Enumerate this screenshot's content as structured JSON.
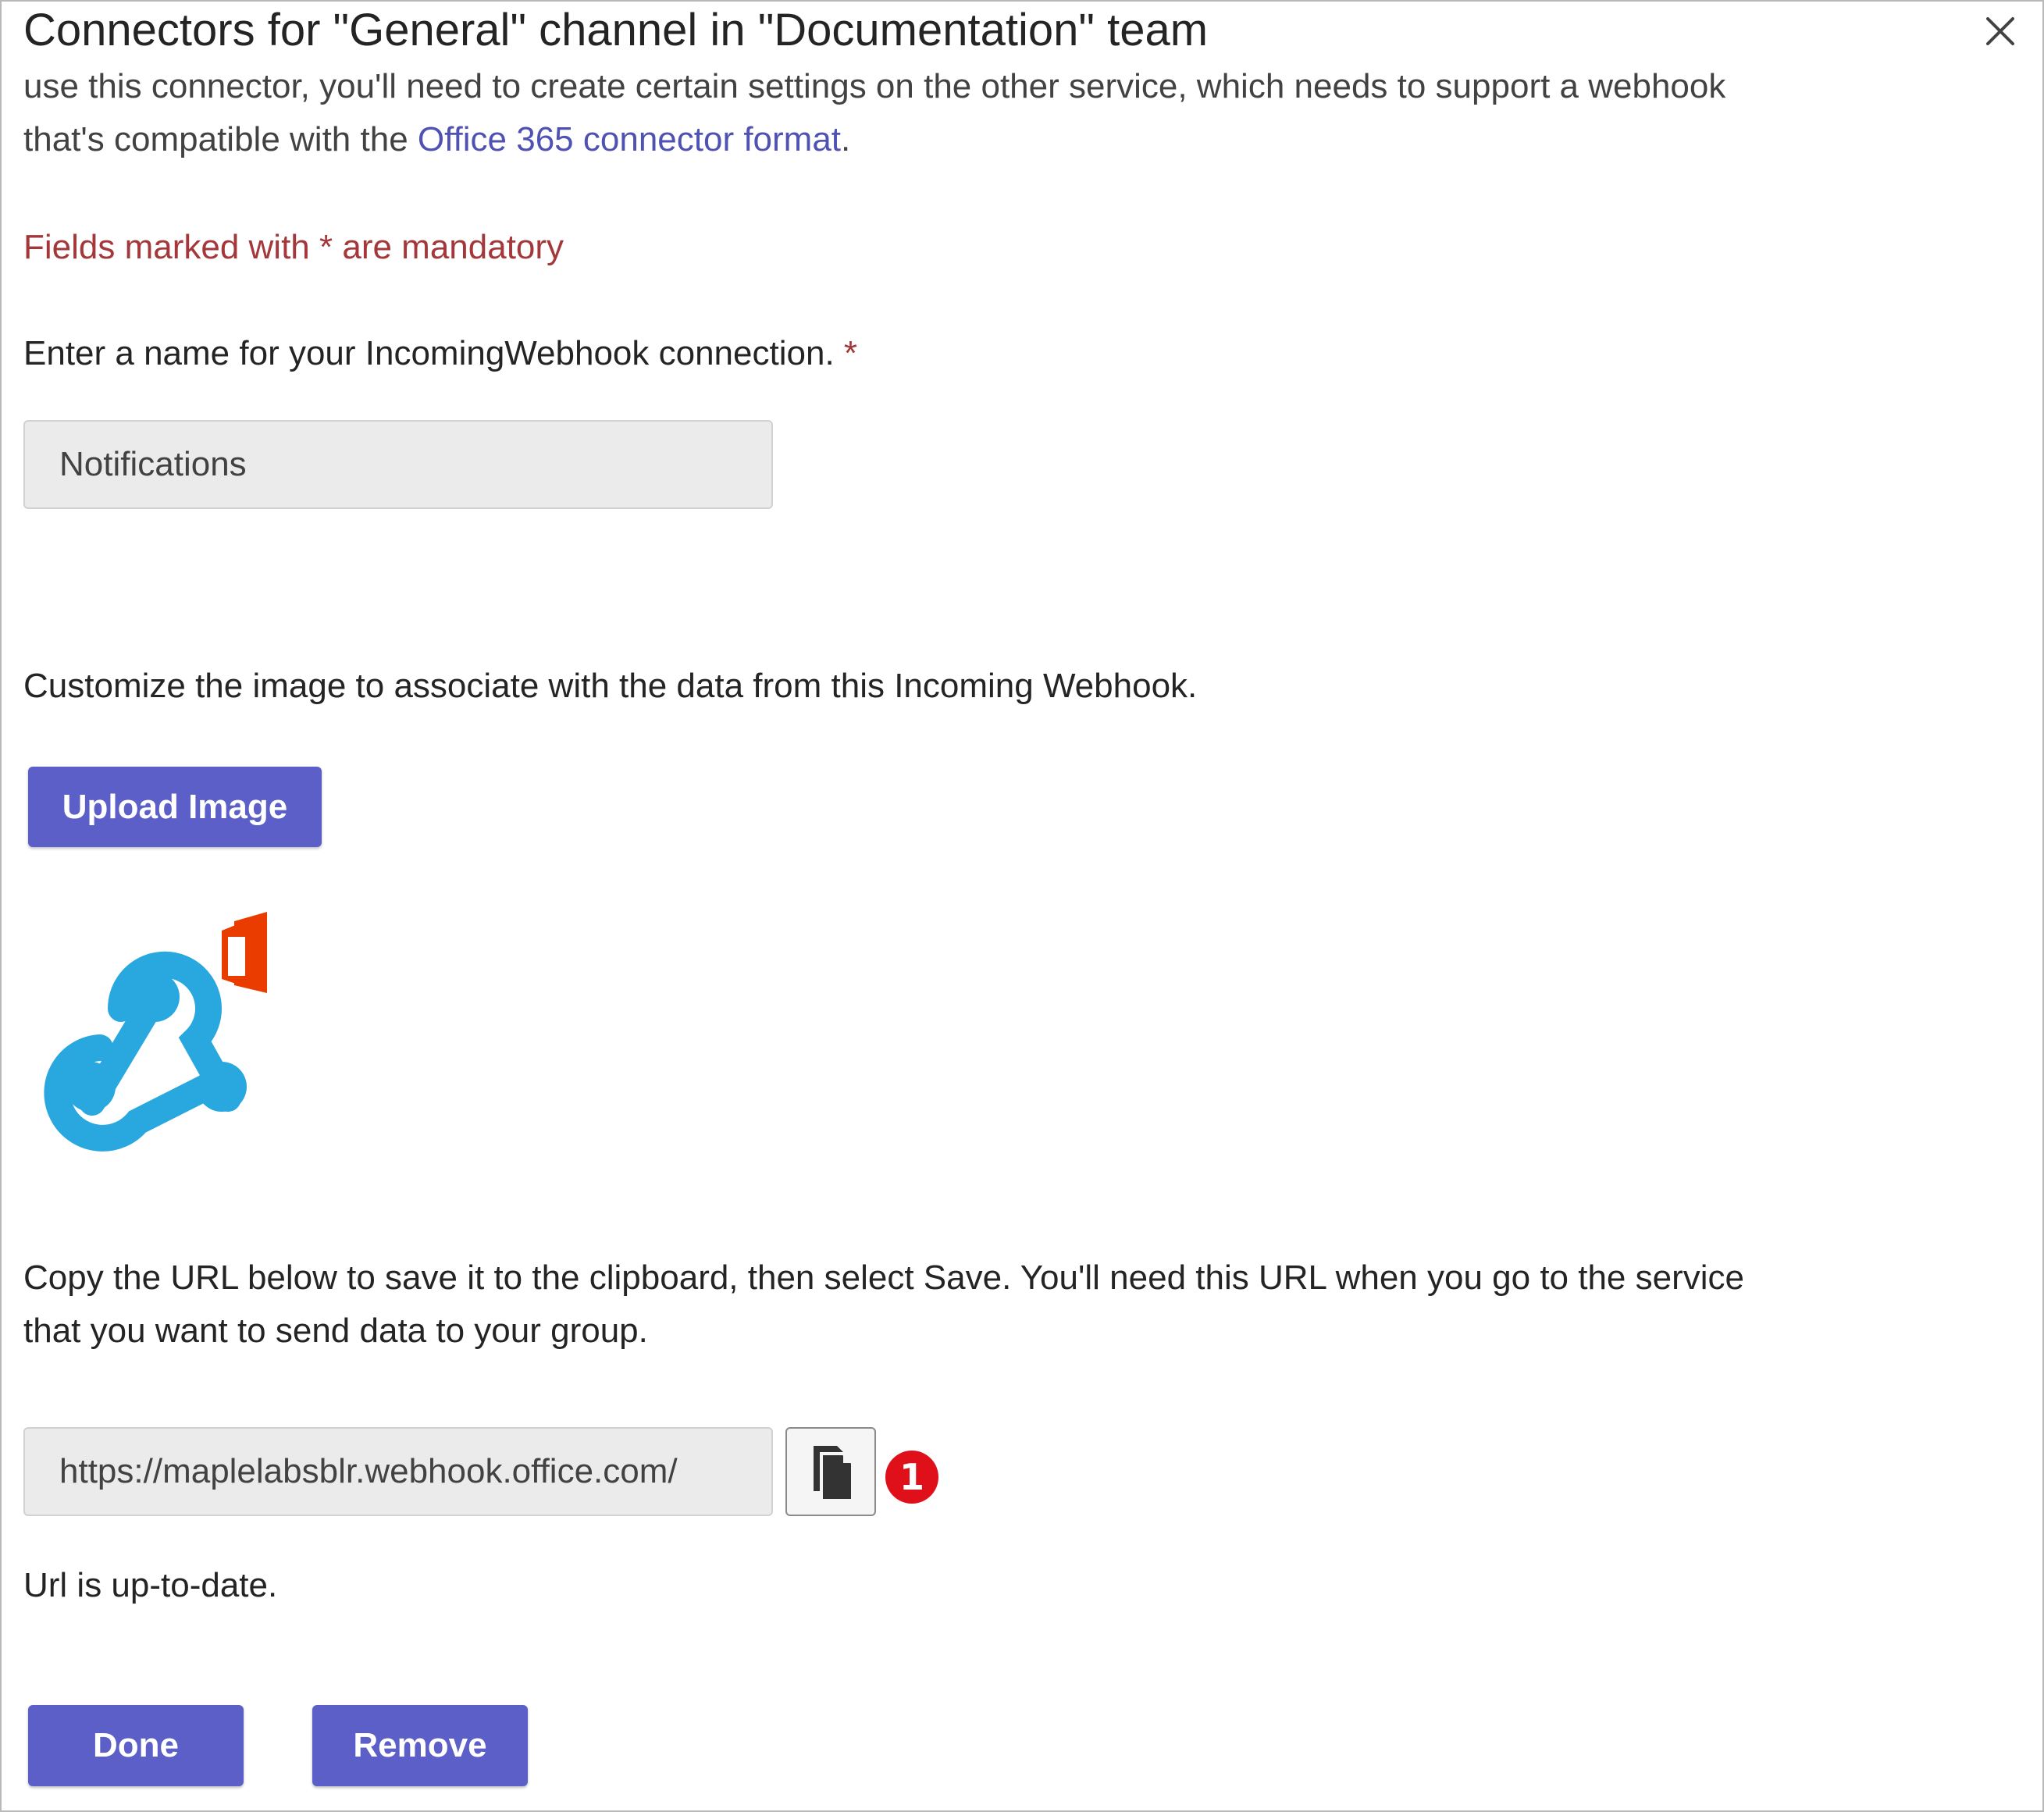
{
  "dialog": {
    "title": "Connectors for \"General\" channel in \"Documentation\" team",
    "intro_line1": "use this connector, you'll need to create certain settings on the other service, which needs to support a webhook",
    "intro_line2_prefix": "that's compatible with the ",
    "intro_link": "Office 365 connector format",
    "intro_line2_suffix": ".",
    "mandatory_note": "Fields marked with * are mandatory",
    "name_label": "Enter a name for your IncomingWebhook connection.",
    "name_required_mark": "*",
    "name_value": "Notifications",
    "image_label": "Customize the image to associate with the data from this Incoming Webhook.",
    "upload_button": "Upload Image",
    "url_instructions_line1": "Copy the URL below to save it to the clipboard, then select Save. You'll need this URL when you go to the service",
    "url_instructions_line2": "that you want to send data to your group.",
    "url_value": "https://maplelabsblr.webhook.office.com/",
    "callout_number": "1",
    "url_status": "Url is up-to-date.",
    "done_button": "Done",
    "remove_button": "Remove"
  },
  "icons": {
    "close": "close-icon",
    "copy": "copy-icon",
    "logo": "incoming-webhook-logo"
  },
  "colors": {
    "accent": "#5b5fc7",
    "link": "#4f52b2",
    "mandatory": "#a4373a",
    "webhook_blue": "#29a8e0",
    "office_orange": "#eb3c00",
    "callout": "#e0101a"
  }
}
